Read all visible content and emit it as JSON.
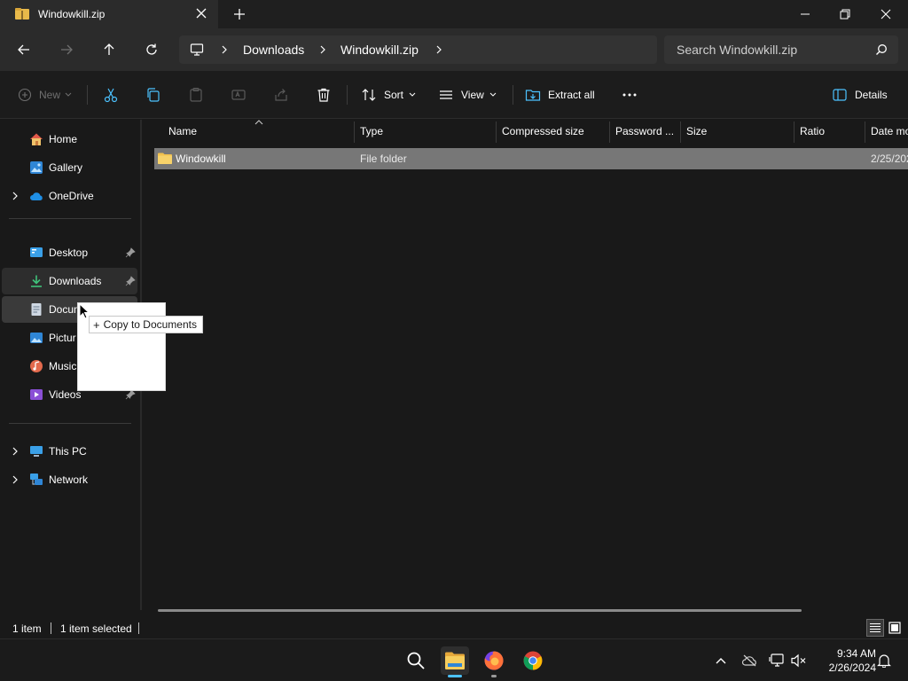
{
  "window": {
    "tab_title": "Windowkill.zip"
  },
  "address": {
    "crumbs": [
      "Downloads",
      "Windowkill.zip"
    ],
    "search_placeholder": "Search Windowkill.zip"
  },
  "toolbar": {
    "new_label": "New",
    "sort_label": "Sort",
    "view_label": "View",
    "extract_label": "Extract all",
    "details_label": "Details"
  },
  "sidebar": {
    "items": [
      {
        "label": "Home",
        "icon": "home-icon"
      },
      {
        "label": "Gallery",
        "icon": "gallery-icon"
      },
      {
        "label": "OneDrive",
        "icon": "onedrive-icon"
      },
      {
        "label": "Desktop",
        "icon": "desktop-icon"
      },
      {
        "label": "Downloads",
        "icon": "downloads-icon"
      },
      {
        "label": "Docun",
        "icon": "documents-icon"
      },
      {
        "label": "Pictur",
        "icon": "pictures-icon"
      },
      {
        "label": "Music",
        "icon": "music-icon"
      },
      {
        "label": "Videos",
        "icon": "videos-icon"
      },
      {
        "label": "This PC",
        "icon": "this-pc-icon"
      },
      {
        "label": "Network",
        "icon": "network-icon"
      }
    ]
  },
  "table": {
    "columns": [
      "Name",
      "Type",
      "Compressed size",
      "Password ...",
      "Size",
      "Ratio",
      "Date mo"
    ],
    "rows": [
      {
        "name": "Windowkill",
        "type": "File folder",
        "date": "2/25/202"
      }
    ]
  },
  "drag": {
    "tooltip": "Copy to Documents",
    "symbol": "+"
  },
  "status": {
    "count": "1 item",
    "selected": "1 item selected"
  },
  "clock": {
    "time": "9:34 AM",
    "date": "2/26/2024"
  },
  "colors": {
    "folder": "#f2c14e",
    "accent": "#4cc2ff",
    "selection": "#777777"
  }
}
